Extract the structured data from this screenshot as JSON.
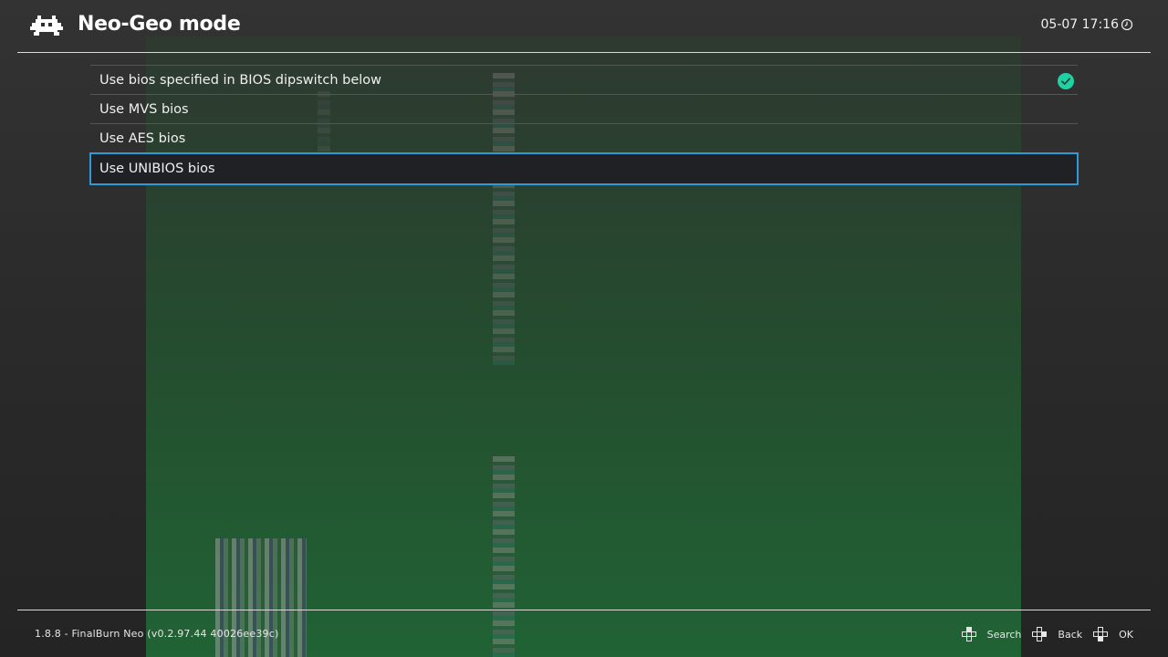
{
  "header": {
    "title": "Neo-Geo mode",
    "clock": "05-07 17:16",
    "logo_icon": "retroarch-invader-icon",
    "clock_icon": "clock-icon"
  },
  "menu": {
    "items": [
      {
        "label": "Use bios specified in BIOS dipswitch below",
        "checked": true,
        "selected": false
      },
      {
        "label": "Use MVS bios",
        "checked": false,
        "selected": false
      },
      {
        "label": "Use AES bios",
        "checked": false,
        "selected": false
      },
      {
        "label": "Use UNIBIOS bios",
        "checked": false,
        "selected": true
      }
    ]
  },
  "footer": {
    "version": "1.8.8 - FinalBurn Neo (v0.2.97.44 40026ee39c)",
    "hints": [
      {
        "label": "Search",
        "icon": "dpad-up-icon"
      },
      {
        "label": "Back",
        "icon": "dpad-left-icon"
      },
      {
        "label": "OK",
        "icon": "dpad-right-icon"
      }
    ]
  },
  "colors": {
    "accent": "#2e9ad6",
    "check": "#1fd1a3",
    "selected_bg": "#202124"
  }
}
